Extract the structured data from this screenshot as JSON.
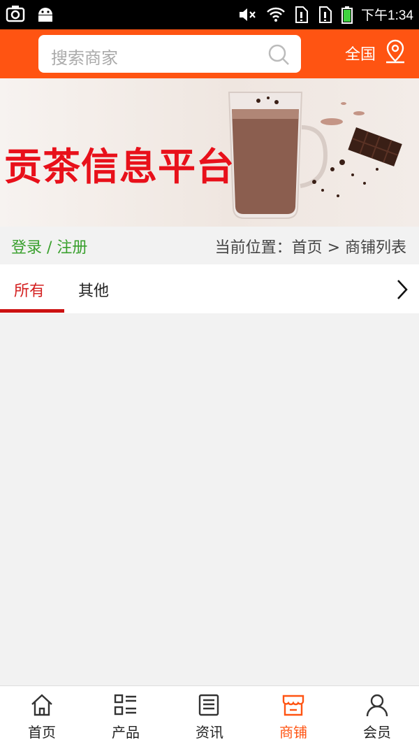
{
  "status_bar": {
    "time": "下午1:34"
  },
  "header": {
    "search_placeholder": "搜索商家",
    "region_label": "全国"
  },
  "banner": {
    "title": "贡茶信息平台"
  },
  "crumb": {
    "login": "登录",
    "separator": " / ",
    "register": "注册",
    "location": "当前位置：首页 > 商铺列表"
  },
  "tabs": {
    "items": [
      {
        "label": "所有"
      },
      {
        "label": "其他"
      }
    ]
  },
  "bottom_nav": {
    "items": [
      {
        "label": "首页",
        "icon": "home-icon"
      },
      {
        "label": "产品",
        "icon": "grid-list-icon"
      },
      {
        "label": "资讯",
        "icon": "news-icon"
      },
      {
        "label": "商铺",
        "icon": "shop-icon"
      },
      {
        "label": "会员",
        "icon": "user-icon"
      }
    ]
  },
  "colors": {
    "brand": "#ff5412",
    "tab_active": "#d42121",
    "login_green": "#3aa02e",
    "banner_red": "#e8101a"
  }
}
